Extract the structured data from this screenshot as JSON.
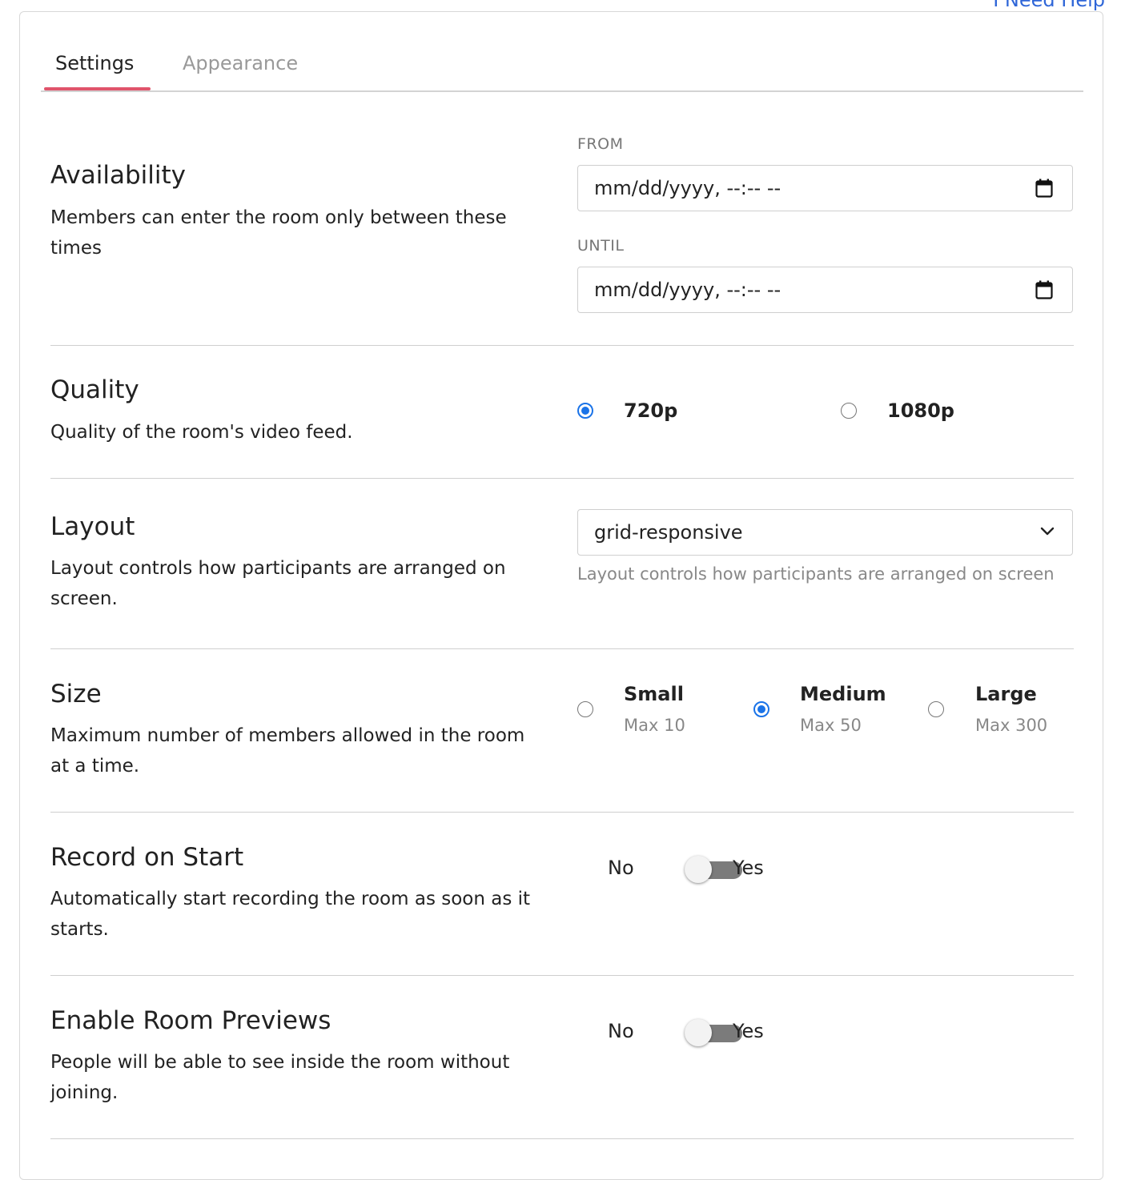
{
  "help_link": "I Need Help",
  "tabs": [
    {
      "label": "Settings",
      "active": true
    },
    {
      "label": "Appearance",
      "active": false
    }
  ],
  "availability": {
    "title": "Availability",
    "description": "Members can enter the room only between these times",
    "from_label": "FROM",
    "from_value": "mm/dd/yyyy, --:-- --",
    "until_label": "UNTIL",
    "until_value": "mm/dd/yyyy, --:-- --"
  },
  "quality": {
    "title": "Quality",
    "description": "Quality of the room's video feed.",
    "options": [
      {
        "label": "720p",
        "checked": true
      },
      {
        "label": "1080p",
        "checked": false
      }
    ]
  },
  "layout": {
    "title": "Layout",
    "description": "Layout controls how participants are arranged on screen.",
    "selected": "grid-responsive",
    "help": "Layout controls how participants are arranged on screen"
  },
  "size": {
    "title": "Size",
    "description": "Maximum number of members allowed in the room at a time.",
    "options": [
      {
        "label": "Small",
        "sub": "Max 10",
        "checked": false
      },
      {
        "label": "Medium",
        "sub": "Max 50",
        "checked": true
      },
      {
        "label": "Large",
        "sub": "Max 300",
        "checked": false
      }
    ]
  },
  "record": {
    "title": "Record on Start",
    "description": "Automatically start recording the room as soon as it starts.",
    "no_label": "No",
    "yes_label": "Yes",
    "enabled": false
  },
  "previews": {
    "title": "Enable Room Previews",
    "description": "People will be able to see inside the room without joining.",
    "no_label": "No",
    "yes_label": "Yes",
    "enabled": false
  },
  "colors": {
    "accent": "#1a73e8",
    "tab_underline": "#e0546b",
    "link": "#2f66d8"
  },
  "icons": [
    "calendar-icon",
    "chevron-down-icon"
  ]
}
